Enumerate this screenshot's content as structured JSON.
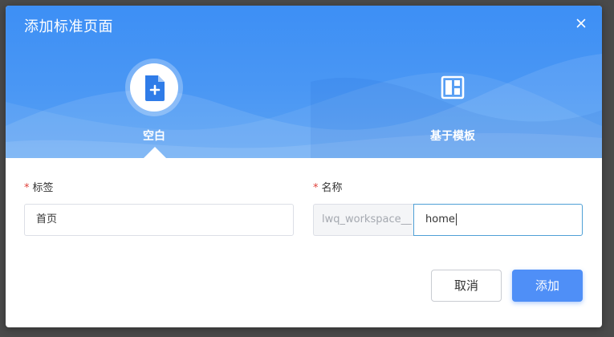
{
  "dialog": {
    "title": "添加标准页面",
    "close_icon": "close-icon"
  },
  "tabs": [
    {
      "label": "空白",
      "icon": "blank-page-add-icon",
      "selected": true
    },
    {
      "label": "基于模板",
      "icon": "template-layout-icon",
      "selected": false
    }
  ],
  "form": {
    "tag": {
      "required_mark": "*",
      "label": "标签",
      "value": "首页"
    },
    "name": {
      "required_mark": "*",
      "label": "名称",
      "prefix": "lwq_workspace__",
      "value": "home"
    }
  },
  "buttons": {
    "cancel": "取消",
    "add": "添加"
  },
  "colors": {
    "header_gradient_top": "#3d8ff5",
    "primary_button": "#4f8ff7",
    "required_star": "#e0413a",
    "focused_input_border": "#4fa0d6"
  }
}
